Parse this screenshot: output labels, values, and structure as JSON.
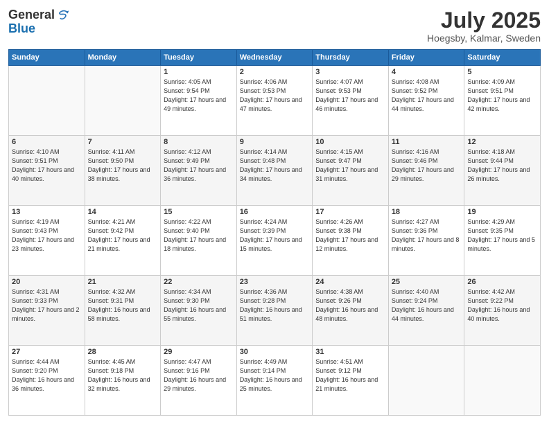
{
  "header": {
    "logo_general": "General",
    "logo_blue": "Blue",
    "month_title": "July 2025",
    "location": "Hoegsby, Kalmar, Sweden"
  },
  "days_of_week": [
    "Sunday",
    "Monday",
    "Tuesday",
    "Wednesday",
    "Thursday",
    "Friday",
    "Saturday"
  ],
  "weeks": [
    [
      {
        "day": "",
        "info": ""
      },
      {
        "day": "",
        "info": ""
      },
      {
        "day": "1",
        "info": "Sunrise: 4:05 AM\nSunset: 9:54 PM\nDaylight: 17 hours and 49 minutes."
      },
      {
        "day": "2",
        "info": "Sunrise: 4:06 AM\nSunset: 9:53 PM\nDaylight: 17 hours and 47 minutes."
      },
      {
        "day": "3",
        "info": "Sunrise: 4:07 AM\nSunset: 9:53 PM\nDaylight: 17 hours and 46 minutes."
      },
      {
        "day": "4",
        "info": "Sunrise: 4:08 AM\nSunset: 9:52 PM\nDaylight: 17 hours and 44 minutes."
      },
      {
        "day": "5",
        "info": "Sunrise: 4:09 AM\nSunset: 9:51 PM\nDaylight: 17 hours and 42 minutes."
      }
    ],
    [
      {
        "day": "6",
        "info": "Sunrise: 4:10 AM\nSunset: 9:51 PM\nDaylight: 17 hours and 40 minutes."
      },
      {
        "day": "7",
        "info": "Sunrise: 4:11 AM\nSunset: 9:50 PM\nDaylight: 17 hours and 38 minutes."
      },
      {
        "day": "8",
        "info": "Sunrise: 4:12 AM\nSunset: 9:49 PM\nDaylight: 17 hours and 36 minutes."
      },
      {
        "day": "9",
        "info": "Sunrise: 4:14 AM\nSunset: 9:48 PM\nDaylight: 17 hours and 34 minutes."
      },
      {
        "day": "10",
        "info": "Sunrise: 4:15 AM\nSunset: 9:47 PM\nDaylight: 17 hours and 31 minutes."
      },
      {
        "day": "11",
        "info": "Sunrise: 4:16 AM\nSunset: 9:46 PM\nDaylight: 17 hours and 29 minutes."
      },
      {
        "day": "12",
        "info": "Sunrise: 4:18 AM\nSunset: 9:44 PM\nDaylight: 17 hours and 26 minutes."
      }
    ],
    [
      {
        "day": "13",
        "info": "Sunrise: 4:19 AM\nSunset: 9:43 PM\nDaylight: 17 hours and 23 minutes."
      },
      {
        "day": "14",
        "info": "Sunrise: 4:21 AM\nSunset: 9:42 PM\nDaylight: 17 hours and 21 minutes."
      },
      {
        "day": "15",
        "info": "Sunrise: 4:22 AM\nSunset: 9:40 PM\nDaylight: 17 hours and 18 minutes."
      },
      {
        "day": "16",
        "info": "Sunrise: 4:24 AM\nSunset: 9:39 PM\nDaylight: 17 hours and 15 minutes."
      },
      {
        "day": "17",
        "info": "Sunrise: 4:26 AM\nSunset: 9:38 PM\nDaylight: 17 hours and 12 minutes."
      },
      {
        "day": "18",
        "info": "Sunrise: 4:27 AM\nSunset: 9:36 PM\nDaylight: 17 hours and 8 minutes."
      },
      {
        "day": "19",
        "info": "Sunrise: 4:29 AM\nSunset: 9:35 PM\nDaylight: 17 hours and 5 minutes."
      }
    ],
    [
      {
        "day": "20",
        "info": "Sunrise: 4:31 AM\nSunset: 9:33 PM\nDaylight: 17 hours and 2 minutes."
      },
      {
        "day": "21",
        "info": "Sunrise: 4:32 AM\nSunset: 9:31 PM\nDaylight: 16 hours and 58 minutes."
      },
      {
        "day": "22",
        "info": "Sunrise: 4:34 AM\nSunset: 9:30 PM\nDaylight: 16 hours and 55 minutes."
      },
      {
        "day": "23",
        "info": "Sunrise: 4:36 AM\nSunset: 9:28 PM\nDaylight: 16 hours and 51 minutes."
      },
      {
        "day": "24",
        "info": "Sunrise: 4:38 AM\nSunset: 9:26 PM\nDaylight: 16 hours and 48 minutes."
      },
      {
        "day": "25",
        "info": "Sunrise: 4:40 AM\nSunset: 9:24 PM\nDaylight: 16 hours and 44 minutes."
      },
      {
        "day": "26",
        "info": "Sunrise: 4:42 AM\nSunset: 9:22 PM\nDaylight: 16 hours and 40 minutes."
      }
    ],
    [
      {
        "day": "27",
        "info": "Sunrise: 4:44 AM\nSunset: 9:20 PM\nDaylight: 16 hours and 36 minutes."
      },
      {
        "day": "28",
        "info": "Sunrise: 4:45 AM\nSunset: 9:18 PM\nDaylight: 16 hours and 32 minutes."
      },
      {
        "day": "29",
        "info": "Sunrise: 4:47 AM\nSunset: 9:16 PM\nDaylight: 16 hours and 29 minutes."
      },
      {
        "day": "30",
        "info": "Sunrise: 4:49 AM\nSunset: 9:14 PM\nDaylight: 16 hours and 25 minutes."
      },
      {
        "day": "31",
        "info": "Sunrise: 4:51 AM\nSunset: 9:12 PM\nDaylight: 16 hours and 21 minutes."
      },
      {
        "day": "",
        "info": ""
      },
      {
        "day": "",
        "info": ""
      }
    ]
  ]
}
